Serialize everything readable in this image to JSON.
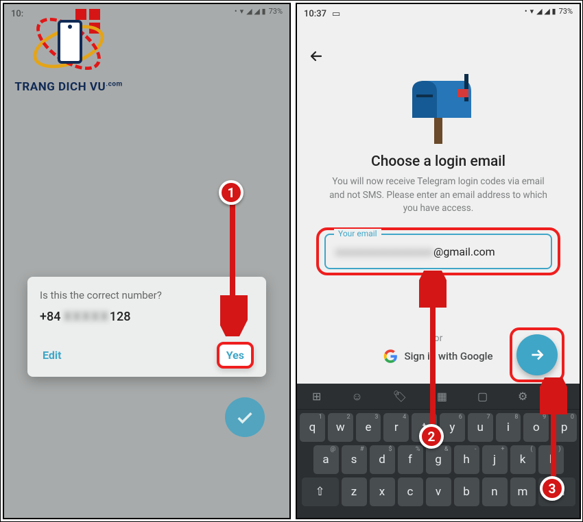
{
  "logo": {
    "text": "TRANG DICH VU",
    "suffix": ".com"
  },
  "badges": {
    "one": "1",
    "two": "2",
    "three": "3"
  },
  "left": {
    "status": {
      "time": "10:",
      "lte": "LTE1",
      "battery": "73%"
    },
    "dialog": {
      "title": "Is this the correct number?",
      "prefix": "+84 ",
      "masked": "XXXXX",
      "suffix": "128",
      "edit": "Edit",
      "yes": "Yes"
    }
  },
  "right": {
    "status": {
      "time": "10:37",
      "lte": "LTE1",
      "battery": "73%"
    },
    "heading": "Choose a login email",
    "subtext": "You will now receive Telegram login codes via email and not SMS. Please enter an email address to which you have access.",
    "input": {
      "label": "Your email",
      "masked": "xxxxxxxxxxxxxxxx",
      "domain": "@gmail.com"
    },
    "or": "or",
    "google": "Sign in with Google"
  },
  "keyboard": {
    "row1": [
      "q",
      "w",
      "e",
      "r",
      "t",
      "y",
      "u",
      "i",
      "o",
      "p"
    ],
    "nums": [
      "1",
      "2",
      "3",
      "4",
      "5",
      "6",
      "7",
      "8",
      "9",
      "0"
    ],
    "row2": [
      "a",
      "s",
      "d",
      "f",
      "g",
      "h",
      "j",
      "k",
      "l"
    ],
    "sup2": [
      "@",
      "#",
      "$",
      "%",
      "&",
      "-",
      "+",
      "(",
      ")"
    ]
  }
}
